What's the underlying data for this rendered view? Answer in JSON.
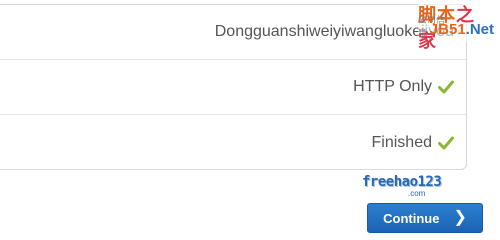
{
  "rows": [
    {
      "label": "Dongguanshiweiyiwangluokejiyou",
      "checked": false
    },
    {
      "label": "HTTP Only",
      "checked": true,
      "check_icon": "check-icon"
    },
    {
      "label": "Finished",
      "checked": true,
      "check_icon": "check-icon"
    }
  ],
  "watermarks": {
    "corner_cn_1": "脚本",
    "corner_cn_2": "之家",
    "corner_small": "公司信息",
    "corner_jb_1": "JB51",
    "corner_jb_2": ".Net",
    "freehao_1": "freehao123",
    "freehao_2": ".com"
  },
  "button": {
    "label": "Continue",
    "chevron": "❯",
    "icon": "chevron-right-icon"
  },
  "colors": {
    "accent": "#1f6cc0",
    "check": "#8ab833",
    "text": "#555555",
    "border": "#d9d9d9"
  }
}
